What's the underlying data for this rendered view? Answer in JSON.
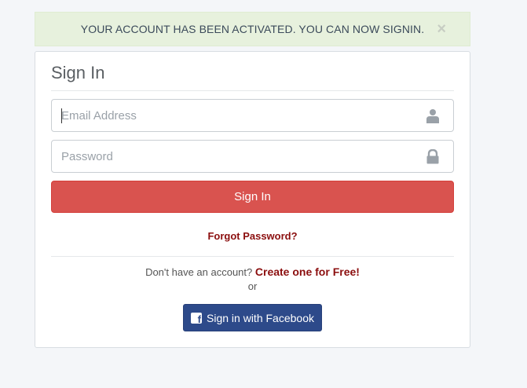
{
  "alert": {
    "message": "YOUR ACCOUNT HAS BEEN ACTIVATED. YOU CAN NOW SIGNIN.",
    "close_symbol": "×",
    "close_icon": "close-icon",
    "background_color": "#e7f1dd"
  },
  "panel": {
    "title": "Sign In"
  },
  "email": {
    "placeholder": "Email Address",
    "value": "",
    "icon": "user-icon"
  },
  "password": {
    "placeholder": "Password",
    "value": "",
    "icon": "lock-icon"
  },
  "signin_button": {
    "label": "Sign In",
    "color": "#d9534f"
  },
  "forgot_password": {
    "label": "Forgot Password?"
  },
  "signup": {
    "prompt": "Don't have an account?",
    "link_label": "Create one for Free!",
    "or": "or"
  },
  "facebook_button": {
    "label": "Sign in with Facebook",
    "icon": "facebook-icon",
    "color": "#2d4a8a"
  }
}
